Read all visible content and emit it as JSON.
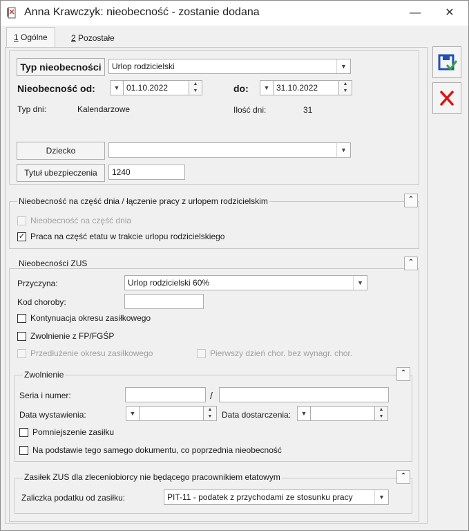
{
  "window": {
    "title": "Anna Krawczyk: nieobecność - zostanie dodana",
    "minimize": "—",
    "close": "✕"
  },
  "tabs": [
    {
      "num": "1",
      "label": "Ogólne"
    },
    {
      "num": "2",
      "label": "Pozostałe"
    }
  ],
  "general": {
    "type_button": "Typ nieobecności",
    "type_value": "Urlop rodzicielski",
    "from_label": "Nieobecność od:",
    "from_value": "01.10.2022",
    "to_label": "do:",
    "to_value": "31.10.2022",
    "days_type_label": "Typ dni:",
    "days_type_value": "Kalendarzowe",
    "days_count_label": "Ilość dni:",
    "days_count_value": "31",
    "child_button": "Dziecko",
    "child_value": "",
    "insurance_button": "Tytuł ubezpieczenia",
    "insurance_value": "1240"
  },
  "partday": {
    "title": "Nieobecność na część dnia / łączenie pracy z urlopem rodzicielskim",
    "cb1": "Nieobecność na część dnia",
    "cb2": "Praca na część etatu w trakcie urlopu rodzicielskiego"
  },
  "zus": {
    "title": "Nieobecności ZUS",
    "reason_label": "Przyczyna:",
    "reason_value": "Urlop rodzicielski 60%",
    "disease_label": "Kod choroby:",
    "disease_value": "",
    "cb_continuation": "Kontynuacja okresu zasiłkowego",
    "cb_exemption": "Zwolnienie z FP/FGŚP",
    "cb_extension": "Przedłużenie okresu zasiłkowego",
    "cb_firstday": "Pierwszy dzień chor. bez wynagr. chor."
  },
  "leave": {
    "title": "Zwolnienie",
    "series_label": "Seria i numer:",
    "slash": "/",
    "issue_label": "Data wystawienia:",
    "delivery_label": "Data dostarczenia:",
    "cb_reduce": "Pomniejszenie zasiłku",
    "cb_same": "Na podstawie tego samego dokumentu, co poprzednia nieobecność"
  },
  "contractor": {
    "title": "Zasiłek ZUS dla zleceniobiorcy nie będącego pracownikiem etatowym",
    "tax_label": "Zaliczka podatku od zasiłku:",
    "tax_value": "PIT-11 - podatek z przychodami ze stosunku pracy"
  }
}
